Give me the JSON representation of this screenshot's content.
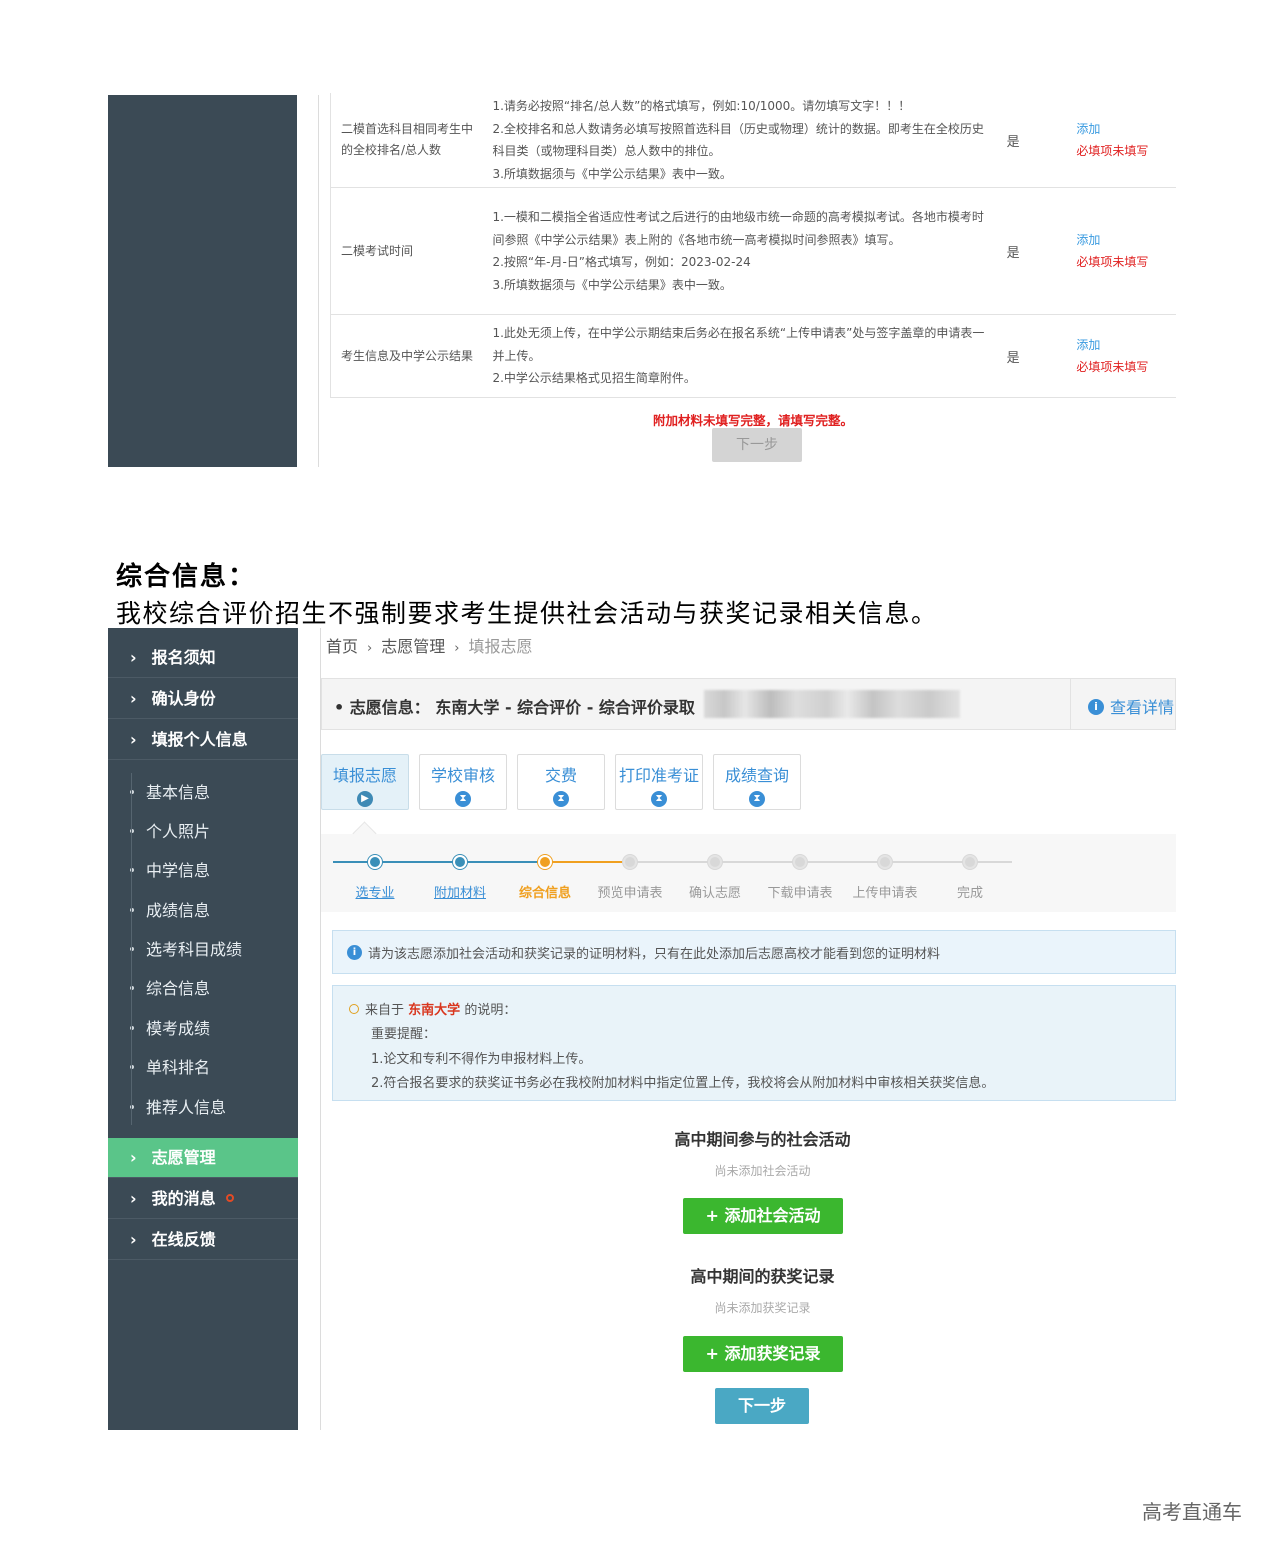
{
  "screenshot_top": {
    "rows": [
      {
        "name": "二模首选科目相同考生中的全校排名/总人数",
        "desc": [
          "1.请务必按照“排名/总人数”的格式填写，例如:10/1000。请勿填写文字！！！",
          "2.全校排名和总人数请务必填写按照首选科目（历史或物理）统计的数据。即考生在全校历史科目类（或物理科目类）总人数中的排位。",
          "3.所填数据须与《中学公示结果》表中一致。"
        ],
        "required": "是",
        "add": "添加",
        "status": "必填项未填写"
      },
      {
        "name": "二模考试时间",
        "desc": [
          "1.一模和二模指全省适应性考试之后进行的由地级市统一命题的高考模拟考试。各地市模考时间参照《中学公示结果》表上附的《各地市统一高考模拟时间参照表》填写。",
          "2.按照“年-月-日”格式填写，例如：2023-02-24",
          "3.所填数据须与《中学公示结果》表中一致。"
        ],
        "required": "是",
        "add": "添加",
        "status": "必填项未填写"
      },
      {
        "name": "考生信息及中学公示结果",
        "desc": [
          "1.此处无须上传，在中学公示期结束后务必在报名系统“上传申请表”处与签字盖章的申请表一并上传。",
          "2.中学公示结果格式见招生简章附件。"
        ],
        "required": "是",
        "add": "添加",
        "status": "必填项未填写"
      }
    ],
    "error": "附加材料未填写完整，请填写完整。",
    "next": "下一步"
  },
  "section": {
    "title": "综合信息：",
    "desc": "我校综合评价招生不强制要求考生提供社会活动与获奖记录相关信息。"
  },
  "sidebar": {
    "main_top": [
      "报名须知",
      "确认身份",
      "填报个人信息"
    ],
    "sub": [
      "基本信息",
      "个人照片",
      "中学信息",
      "成绩信息",
      "选考科目成绩",
      "综合信息",
      "模考成绩",
      "单科排名",
      "推荐人信息"
    ],
    "main_bottom": [
      "志愿管理",
      "我的消息",
      "在线反馈"
    ],
    "active": "志愿管理"
  },
  "breadcrumb": {
    "home": "首页",
    "mgmt": "志愿管理",
    "current": "填报志愿",
    "sep": "›"
  },
  "infobar": {
    "text": "志愿信息： 东南大学 - 综合评价 - 综合评价录取",
    "detail": "查看详情"
  },
  "tabs": [
    "填报志愿",
    "学校审核",
    "交费",
    "打印准考证",
    "成绩查询"
  ],
  "steps": [
    {
      "label": "选专业",
      "state": "done"
    },
    {
      "label": "附加材料",
      "state": "done"
    },
    {
      "label": "综合信息",
      "state": "current"
    },
    {
      "label": "预览申请表",
      "state": "todo"
    },
    {
      "label": "确认志愿",
      "state": "todo"
    },
    {
      "label": "下载申请表",
      "state": "todo"
    },
    {
      "label": "上传申请表",
      "state": "todo"
    },
    {
      "label": "完成",
      "state": "todo"
    }
  ],
  "tip": "请为该志愿添加社会活动和获奖记录的证明材料，只有在此处添加后志愿高校才能看到您的证明材料",
  "note": {
    "from_prefix": "来自于",
    "school": "东南大学",
    "from_suffix": "的说明：",
    "heading": "重要提醒：",
    "line1": "1.论文和专利不得作为申报材料上传。",
    "line2": "2.符合报名要求的获奖证书务必在我校附加材料中指定位置上传，我校将会从附加材料中审核相关获奖信息。"
  },
  "social": {
    "title": "高中期间参与的社会活动",
    "empty": "尚未添加社会活动",
    "button": "+ 添加社会活动"
  },
  "awards": {
    "title": "高中期间的获奖记录",
    "empty": "尚未添加获奖记录",
    "button": "+ 添加获奖记录"
  },
  "next_button": "下一步",
  "watermark": "高考直通车",
  "colors": {
    "sidebar": "#3b4a55",
    "active_nav": "#5ac589",
    "link": "#3a8fd6",
    "warn": "#e02020",
    "green_btn": "#3bb72f",
    "next_btn": "#4aa8c4",
    "current_step": "#f0a020"
  }
}
